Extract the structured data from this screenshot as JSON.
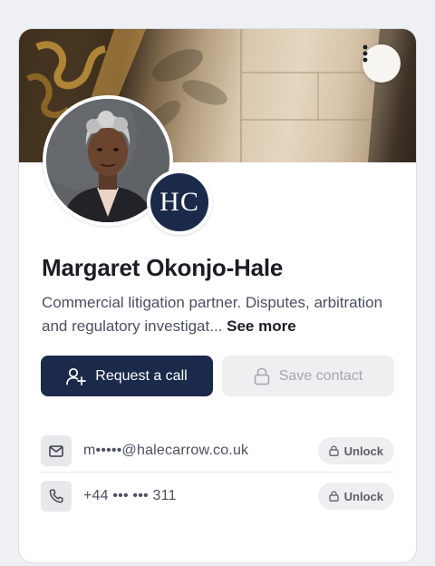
{
  "profile": {
    "name": "Margaret Okonjo-Hale",
    "bio": "Commercial litigation partner. Disputes, arbitration and regulatory investigat...",
    "see_more": "See more",
    "firm_initials": "HC"
  },
  "actions": {
    "request_call": "Request a call",
    "save_contact": "Save contact"
  },
  "contacts": [
    {
      "type": "email",
      "icon": "mail-icon",
      "value": "m•••••@halecarrow.co.uk",
      "action": "Unlock"
    },
    {
      "type": "phone",
      "icon": "phone-icon",
      "value": "+44 ••• ••• 311",
      "action": "Unlock"
    }
  ],
  "colors": {
    "primary": "#1b2a4a",
    "badge": "#1b2a4a",
    "muted_button": "#efeff1"
  }
}
